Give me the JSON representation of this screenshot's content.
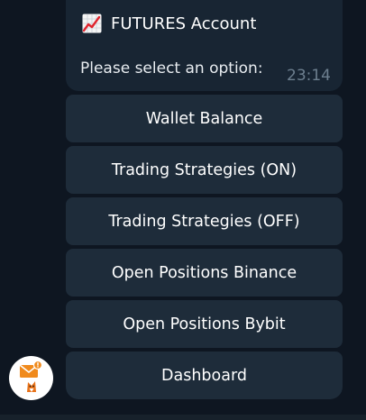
{
  "message": {
    "icon": "chart-increasing-emoji",
    "title": "FUTURES Account",
    "body": "Please select an option:",
    "time": "23:14"
  },
  "keyboard": {
    "buttons": [
      {
        "label": "Wallet Balance"
      },
      {
        "label": "Trading Strategies (ON)"
      },
      {
        "label": "Trading Strategies (OFF)"
      },
      {
        "label": "Open Positions Binance"
      },
      {
        "label": "Open Positions Bybit"
      },
      {
        "label": "Dashboard"
      }
    ]
  },
  "sender": {
    "avatar_icon": "mail-fox-avatar"
  },
  "colors": {
    "background": "#0e1621",
    "bubble": "#182533",
    "button": "#1e2c3a",
    "timestamp": "#6d7f8f"
  }
}
